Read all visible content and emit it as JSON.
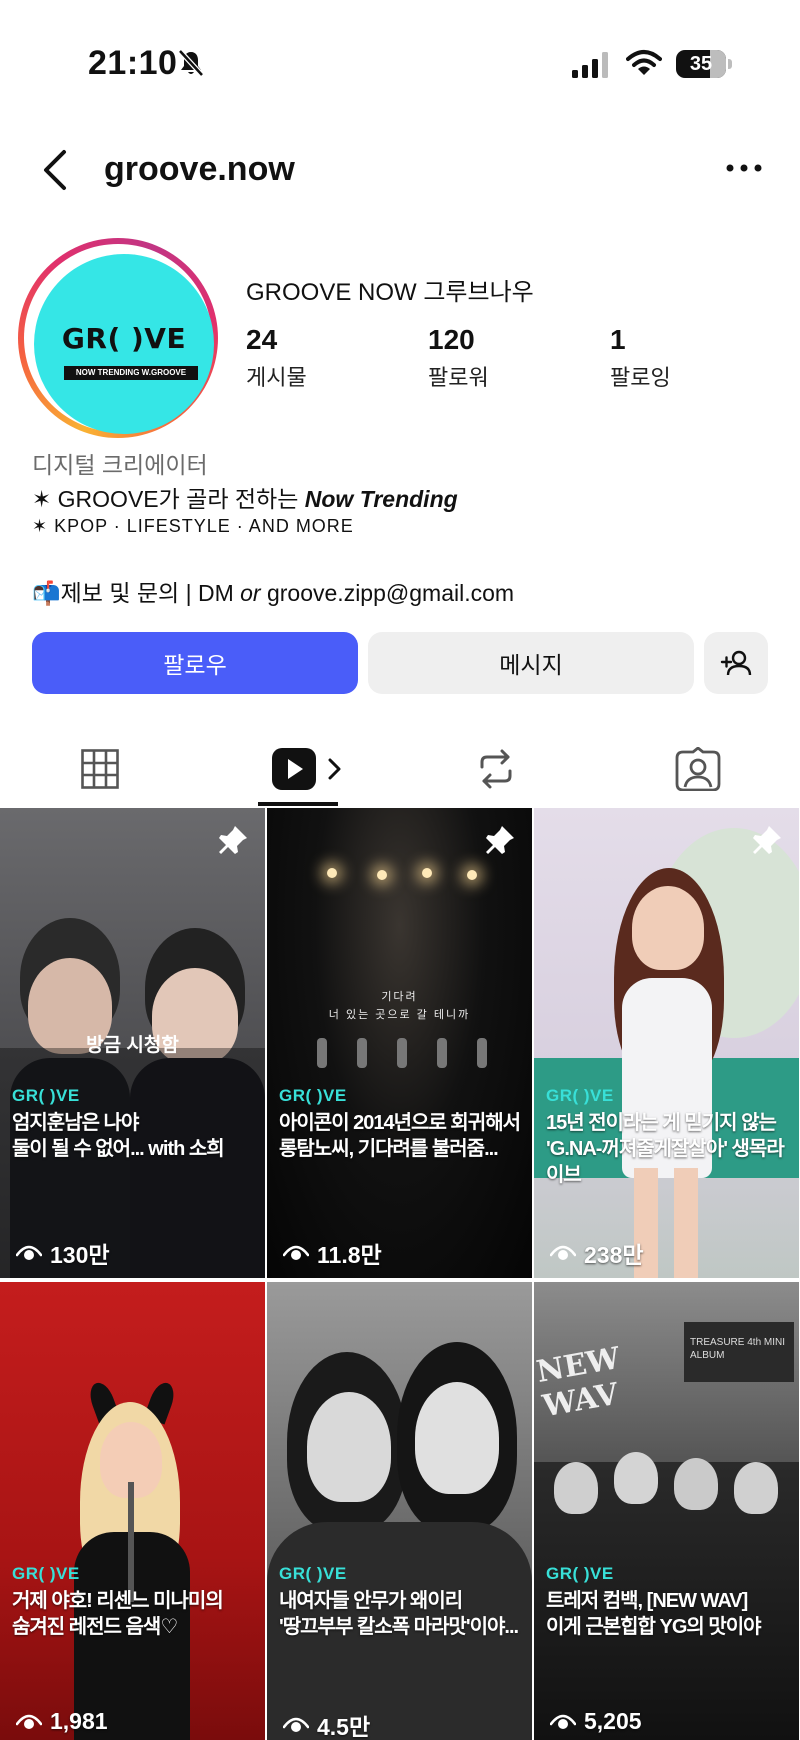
{
  "status_bar": {
    "time": "21:10",
    "battery": "35"
  },
  "header": {
    "username": "groove.now"
  },
  "profile": {
    "avatar_logo": "GR(    )VE",
    "avatar_tag": "NOW TRENDING W.GROOVE",
    "display_name": "GROOVE NOW 그루브나우",
    "stats": [
      {
        "value": "24",
        "label": "게시물"
      },
      {
        "value": "120",
        "label": "팔로워"
      },
      {
        "value": "1",
        "label": "팔로잉"
      }
    ],
    "category": "디지털 크리에이터",
    "bio_line1_prefix": "✶ GROOVE가 골라 전하는 ",
    "bio_line1_emph": "Now Trending",
    "bio_line2": "✶ KPOP · LIFESTYLE · AND MORE",
    "contact_prefix": "📬제보 및 문의 | DM ",
    "contact_or": "or",
    "contact_email": " groove.zipp@gmail.com"
  },
  "buttons": {
    "follow": "팔로우",
    "message": "메시지"
  },
  "reels": [
    {
      "brand": "GR(    )VE",
      "caption_line1": "엄지훈남은 나야",
      "caption_line2": "둘이 될 수 없어... with 소희",
      "views": "130만",
      "pinned": true,
      "overlay": "방금 시청함"
    },
    {
      "brand": "GR(    )VE",
      "caption_line1": "아이콘이 2014년으로 회귀해서",
      "caption_line2": "롱탐노씨, 기다려를 불러줌...",
      "views": "11.8만",
      "pinned": true,
      "stage_line1": "기다려",
      "stage_line2": "너 있는 곳으로 갈 테니까"
    },
    {
      "brand": "GR(    )VE",
      "caption_line1": "15년 전이라는 게 믿기지 않는",
      "caption_line2": "'G.NA-꺼져줄게잘살아' 생목라이브",
      "views": "238만",
      "pinned": true
    },
    {
      "brand": "GR(    )VE",
      "caption_line1": "거제 야호! 리센느 미나미의",
      "caption_line2": "숨겨진 레전드 음색♡",
      "views": "1,981",
      "pinned": false
    },
    {
      "brand": "GR(    )VE",
      "caption_line1": "내여자들 안무가 왜이리",
      "caption_line2": "'땅끄부부 칼소폭 마라맛'이야...",
      "views": "4.5만",
      "pinned": false
    },
    {
      "brand": "GR(    )VE",
      "caption_line1": "트레저 컴백, [NEW WAV]",
      "caption_line2": "이게 근본힙합 YG의 맛이야",
      "views": "5,205",
      "pinned": false,
      "sign_text": "NEW WAV",
      "sign_small": "TREASURE 4th MINI ALBUM"
    }
  ]
}
